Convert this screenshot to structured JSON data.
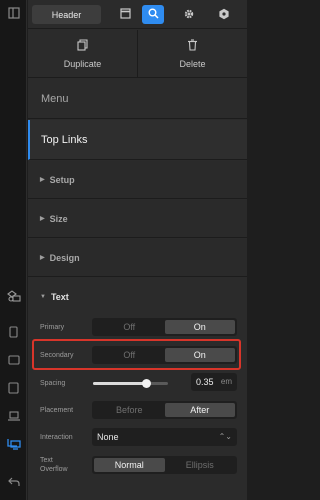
{
  "toolbar": {
    "header_tab": "Header"
  },
  "actions": {
    "duplicate": "Duplicate",
    "delete": "Delete"
  },
  "nav": {
    "menu": "Menu",
    "current": "Top Links"
  },
  "sections": {
    "setup": "Setup",
    "size": "Size",
    "design": "Design",
    "text": "Text"
  },
  "text": {
    "primary": {
      "label": "Primary",
      "off": "Off",
      "on": "On",
      "selected": "On"
    },
    "secondary": {
      "label": "Secondary",
      "off": "Off",
      "on": "On",
      "selected": "On"
    },
    "spacing": {
      "label": "Spacing",
      "value": "0.35",
      "unit": "em",
      "slider_fraction": 0.7
    },
    "placement": {
      "label": "Placement",
      "before": "Before",
      "after": "After",
      "selected": "After"
    },
    "interaction": {
      "label": "Interaction",
      "value": "None"
    },
    "overflow": {
      "label_line1": "Text",
      "label_line2": "Overflow",
      "normal": "Normal",
      "ellipsis": "Ellipsis",
      "selected": "Normal"
    }
  },
  "colors": {
    "accent": "#2f8cf0",
    "highlight": "#d8352a"
  }
}
